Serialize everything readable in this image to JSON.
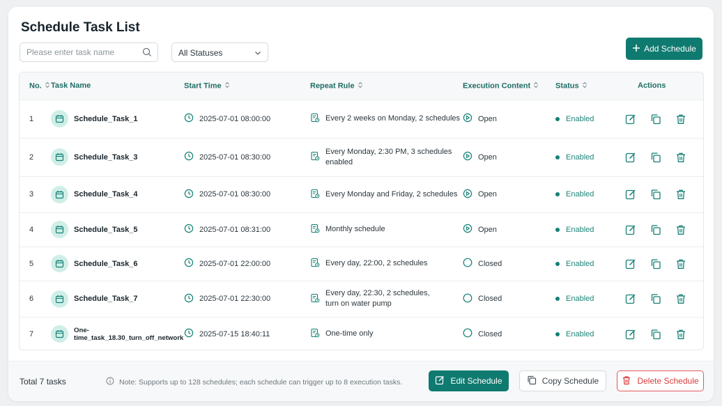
{
  "page": {
    "title": "Schedule Task List"
  },
  "toolbar": {
    "search_placeholder": "Please enter task name",
    "status_filter": "All Statuses",
    "add_label": "Add Schedule"
  },
  "table": {
    "headers": {
      "no": "No.",
      "task_name": "Task Name",
      "start_time": "Start Time",
      "repeat_rule": "Repeat Rule",
      "execution_content": "Execution Content",
      "status": "Status",
      "actions": "Actions"
    },
    "rows": [
      {
        "no": "1",
        "name": "Schedule_Task_1",
        "start": "2025-07-01 08:00:00",
        "repeat": [
          "Every 2 weeks on Monday, 2 schedules"
        ],
        "exec": "Open",
        "status": "Enabled"
      },
      {
        "no": "2",
        "name": "Schedule_Task_3",
        "start": "2025-07-01 08:30:00",
        "repeat": [
          "Every Monday, 2:30 PM, 3 schedules",
          "enabled"
        ],
        "exec": "Open",
        "status": "Enabled"
      },
      {
        "no": "3",
        "name": "Schedule_Task_4",
        "start": "2025-07-01 08:30:00",
        "repeat": [
          "Every Monday and Friday, 2 schedules"
        ],
        "exec": "Open",
        "status": "Enabled"
      },
      {
        "no": "4",
        "name": "Schedule_Task_5",
        "start": "2025-07-01 08:31:00",
        "repeat": [
          "Monthly schedule"
        ],
        "exec": "Open",
        "status": "Enabled"
      },
      {
        "no": "5",
        "name": "Schedule_Task_6",
        "start": "2025-07-01 22:00:00",
        "repeat": [
          "Every day, 22:00, 2 schedules"
        ],
        "exec": "Closed",
        "status": "Enabled"
      },
      {
        "no": "6",
        "name": "Schedule_Task_7",
        "start": "2025-07-01 22:30:00",
        "repeat": [
          "Every day, 22:30, 2 schedules,",
          "turn on water pump"
        ],
        "exec": "Closed",
        "status": "Enabled"
      },
      {
        "no": "7",
        "name": "One-time_task_18.30_turn_off_network",
        "start": "2025-07-15 18:40:11",
        "repeat": [
          "One-time only"
        ],
        "exec": "Closed",
        "status": "Enabled"
      }
    ]
  },
  "footer": {
    "total": "Total 7 tasks",
    "note": "Note: Supports up to 128 schedules; each schedule can trigger up to 8 execution tasks.",
    "edit_label": "Edit Schedule",
    "copy_label": "Copy Schedule",
    "delete_label": "Delete Schedule"
  },
  "colors": {
    "accent": "#0f7a70",
    "header_text": "#1f6e66",
    "enabled": "#1f857a",
    "danger": "#d93a3a"
  }
}
